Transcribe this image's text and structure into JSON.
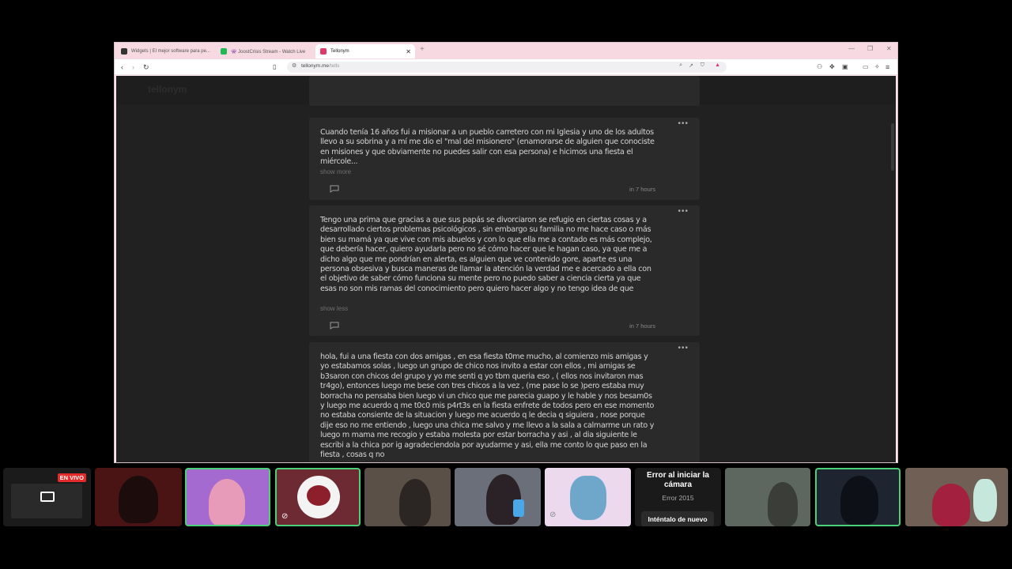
{
  "browser": {
    "tabs": [
      {
        "label": "Widgets | El mejor software para pe...",
        "active": false
      },
      {
        "label": "👾 JoostCrisis Stream - Watch Live",
        "active": false
      },
      {
        "label": "Tellonym",
        "active": true
      }
    ],
    "url": {
      "host": "tellonym.me",
      "path": "/tells"
    }
  },
  "site": {
    "brand": "tellonym",
    "nav": [
      "home-icon",
      "search-icon",
      "inbox-icon",
      "feed-icon",
      "avatar"
    ]
  },
  "tells": [
    {
      "text": "Cuando tenía 16 años fui a misionar a un pueblo carretero con mi Iglesia y uno de los adultos llevo a su sobrina y a mí me dio el \"mal del misionero\" (enamorarse de alguien que conociste en misiones y que obviamente no puedes salir con esa persona) e hicimos una fiesta el miércole...",
      "toggle": "show more",
      "time": "in 7 hours"
    },
    {
      "text": "Tengo una prima que gracias a que sus papás se divorciaron se refugio en ciertas cosas y a desarrollado ciertos problemas psicológicos , sin embargo su familia no me hace caso o más bien su mamá ya que vive con mis abuelos y con lo que ella me a contado es más complejo, que debería hacer, quiero ayudarla pero no sé cómo hacer que le hagan caso, ya que me a dicho algo que me pondrían en alerta, es alguien que ve contenido gore, aparte es una persona obsesiva y busca maneras de llamar la atención la verdad me e acercado a ella con el objetivo de saber cómo funciona su mente pero no puedo saber a ciencia cierta ya que esas no son mis ramas del conocimiento pero quiero hacer algo y no tengo idea de que",
      "toggle": "show less",
      "time": "in 7 hours"
    },
    {
      "text": "hola, fui a una fiesta con dos amigas , en esa fiesta t0me mucho, al comienzo mis amigas y yo estabamos solas , luego un grupo de chico nos invito a estar con ellos , mi amigas se b3saron con chicos del grupo y yo me senti q yo tbm queria eso , ( ellos nos invitaron mas tr4go), entonces luego me bese con tres chicos a la vez , (me pase lo se )pero estaba muy borracha no pensaba bien luego vi un chico que me parecia guapo y le hable y nos besam0s y luego me acuerdo q me t0c0 mis p4rt3s en la fiesta enfrete de todos pero en ese momento no estaba consiente de la situacion y luego me acuerdo q le decia q siguiera , nose porque dije eso no me entiendo , luego una chica me salvo y me llevo a la sala a calmarme un rato y luego m mama me recogio y estaba molesta por estar borracha y asi , al dia siguiente le escribi a la chica por ig agradeciendola por ayudarme y asi, ella me conto lo que paso en la fiesta , cosas q no",
      "toggle": "",
      "time": ""
    }
  ],
  "stream": {
    "live_badge": "EN VIVO",
    "camera_error": {
      "title": "Error al iniciar la cámara",
      "code": "Error 2015",
      "retry": "Inténtalo de nuevo"
    }
  },
  "colors": {
    "page_bg": "#212121",
    "card_bg": "#2a2a2a",
    "accent": "#2bb3a8",
    "live": "#e32b2b",
    "highlight": "#4bd07a"
  }
}
